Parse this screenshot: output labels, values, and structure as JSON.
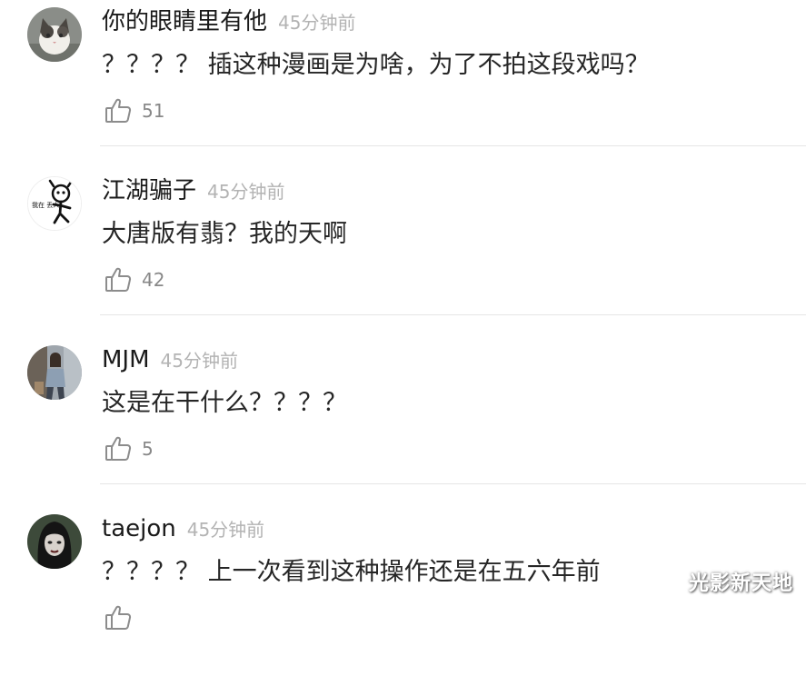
{
  "comments": [
    {
      "username": "你的眼睛里有他",
      "time": "45分钟前",
      "text": "？？？？ 插这种漫画是为啥，为了不拍这段戏吗？",
      "likes": "51",
      "avatar": "cat-avatar"
    },
    {
      "username": "江湖骗子",
      "time": "45分钟前",
      "text": "大唐版有翡？我的天啊",
      "likes": "42",
      "avatar": "stickman-avatar",
      "avatar_text": "我在 丢人"
    },
    {
      "username": "MJM",
      "time": "45分钟前",
      "text": "这是在干什么？？？？",
      "likes": "5",
      "avatar": "person-photo-avatar"
    },
    {
      "username": "taejon",
      "time": "45分钟前",
      "text": "？？？？ 上一次看到这种操作还是在五六年前",
      "likes": "",
      "avatar": "dark-portrait-avatar"
    }
  ],
  "watermark": "光影新天地",
  "colors": {
    "username": "#1a1a1a",
    "timestamp": "#b3b3b3",
    "like": "#888888",
    "divider": "#e6e6e6"
  }
}
